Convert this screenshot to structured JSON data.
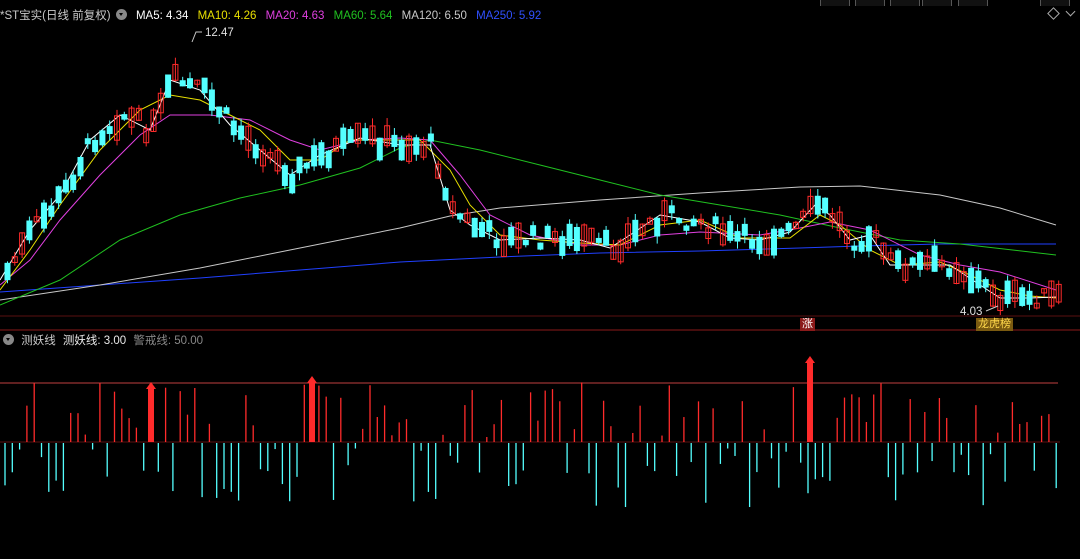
{
  "header": {
    "stock_name": "*ST宝实(日线 前复权)",
    "ma5": "MA5: 4.34",
    "ma10": "MA10: 4.26",
    "ma20": "MA20: 4.63",
    "ma60": "MA60: 5.64",
    "ma120": "MA120: 6.50",
    "ma250": "MA250: 5.92"
  },
  "colors": {
    "ma5": "#ffffff",
    "ma10": "#e8e000",
    "ma20": "#e040e0",
    "ma60": "#20c020",
    "ma120": "#c8c8c8",
    "ma250": "#2040ff",
    "up": "#ff2b2b",
    "down": "#54ffff",
    "axis": "#8b1a1a"
  },
  "annotations": {
    "high_label": "12.47",
    "low_label": "4.03",
    "zhang_badge": "涨",
    "lhb_badge": "龙虎榜"
  },
  "indicator": {
    "title": "测妖线",
    "line_label": "测妖线: 3.00",
    "warning_label": "警戒线: 50.00"
  }
}
